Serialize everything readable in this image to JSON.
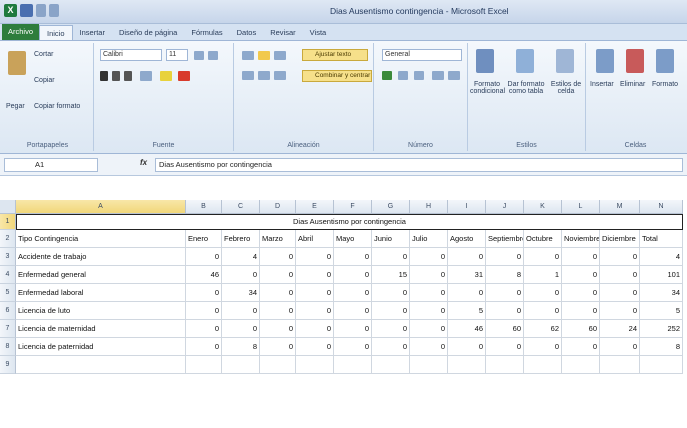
{
  "window": {
    "title": "Dias Ausentismo contingencia - Microsoft Excel"
  },
  "ribbon_tabs": [
    "Archivo",
    "Inicio",
    "Insertar",
    "Diseño de página",
    "Fórmulas",
    "Datos",
    "Revisar",
    "Vista"
  ],
  "ribbon": {
    "clipboard": {
      "paste": "Pegar",
      "cut": "Cortar",
      "copy": "Copiar",
      "format_painter": "Copiar formato",
      "label": "Portapapeles"
    },
    "font": {
      "name": "Calibri",
      "size": "11",
      "label": "Fuente"
    },
    "alignment": {
      "wrap": "Ajustar texto",
      "merge": "Combinar y centrar",
      "label": "Alineación"
    },
    "number": {
      "format": "General",
      "label": "Número"
    },
    "styles": {
      "conditional": "Formato condicional",
      "table": "Dar formato como tabla",
      "cell": "Estilos de celda",
      "label": "Estilos"
    },
    "cells": {
      "insert": "Insertar",
      "delete": "Eliminar",
      "format": "Formato",
      "label": "Celdas"
    }
  },
  "formula_bar": {
    "name_box": "A1",
    "fx": "fx",
    "formula": "Dias Ausentismo por contingencia"
  },
  "sheet": {
    "columns": [
      "A",
      "B",
      "C",
      "D",
      "E",
      "F",
      "G",
      "H",
      "I",
      "J",
      "K",
      "L",
      "M",
      "N"
    ],
    "row_numbers": [
      "1",
      "2",
      "3",
      "4",
      "5",
      "6",
      "7",
      "8",
      "9"
    ],
    "title": "Dias Ausentismo por contingencia",
    "headers": [
      "Tipo Contingencia",
      "Enero",
      "Febrero",
      "Marzo",
      "Abril",
      "Mayo",
      "Junio",
      "Julio",
      "Agosto",
      "Septiembre",
      "Octubre",
      "Noviembre",
      "Diciembre",
      "Total"
    ],
    "rows": [
      {
        "label": "Accidente de trabajo",
        "values": [
          "0",
          "4",
          "0",
          "0",
          "0",
          "0",
          "0",
          "0",
          "0",
          "0",
          "0",
          "0",
          "4"
        ]
      },
      {
        "label": "Enfermedad general",
        "values": [
          "46",
          "0",
          "0",
          "0",
          "0",
          "15",
          "0",
          "31",
          "8",
          "1",
          "0",
          "0",
          "101"
        ]
      },
      {
        "label": "Enfermedad laboral",
        "values": [
          "0",
          "34",
          "0",
          "0",
          "0",
          "0",
          "0",
          "0",
          "0",
          "0",
          "0",
          "0",
          "34"
        ]
      },
      {
        "label": "Licencia de luto",
        "values": [
          "0",
          "0",
          "0",
          "0",
          "0",
          "0",
          "0",
          "5",
          "0",
          "0",
          "0",
          "0",
          "5"
        ]
      },
      {
        "label": "Licencia de maternidad",
        "values": [
          "0",
          "0",
          "0",
          "0",
          "0",
          "0",
          "0",
          "46",
          "60",
          "62",
          "60",
          "24",
          "252"
        ]
      },
      {
        "label": "Licencia de paternidad",
        "values": [
          "0",
          "8",
          "0",
          "0",
          "0",
          "0",
          "0",
          "0",
          "0",
          "0",
          "0",
          "0",
          "8"
        ]
      }
    ]
  }
}
